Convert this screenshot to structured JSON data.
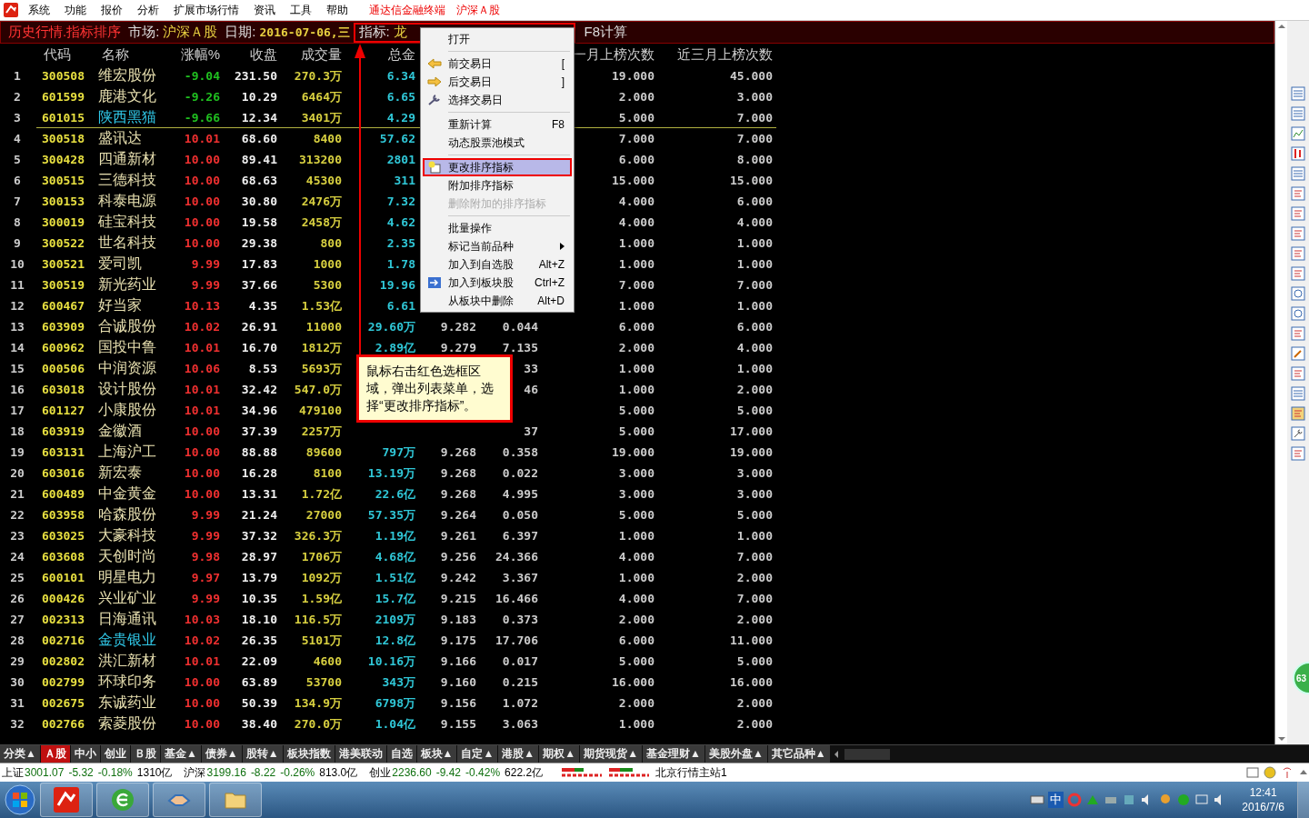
{
  "menubar": {
    "items": [
      "系统",
      "功能",
      "报价",
      "分析",
      "扩展市场行情",
      "资讯",
      "工具",
      "帮助"
    ],
    "brand": "通达信金融终端",
    "market": "沪深Ａ股"
  },
  "header": {
    "title": "历史行情.指标排序",
    "market_label": "市场:",
    "market": "沪深Ａ股",
    "date_label": "日期:",
    "date": "2016-07-06,三",
    "indicator_label": "指标:",
    "indicator": "龙",
    "recalc": "F8计算"
  },
  "table": {
    "columns": [
      "代码",
      "名称",
      "涨幅%",
      "收盘",
      "成交量",
      "总金",
      null,
      null,
      "一月上榜次数",
      "近三月上榜次数"
    ],
    "top_rows": [
      {
        "no": "1",
        "marked": false,
        "cells": [
          "300508",
          "维宏股份",
          "-9.04",
          "231.50",
          "270.3万",
          "6.34",
          null,
          null,
          "19.000",
          "45.000"
        ]
      },
      {
        "no": "2",
        "marked": false,
        "cells": [
          "601599",
          "鹿港文化",
          "-9.26",
          "10.29",
          "6464万",
          "6.65",
          null,
          null,
          "2.000",
          "3.000"
        ]
      },
      {
        "no": "3",
        "marked": true,
        "cells": [
          "601015",
          "陕西黑猫",
          "-9.66",
          "12.34",
          "3401万",
          "4.29",
          null,
          null,
          "5.000",
          "7.000"
        ]
      }
    ],
    "rows": [
      {
        "no": "4",
        "marked": false,
        "cells": [
          "300518",
          "盛讯达",
          "10.01",
          "68.60",
          "8400",
          "57.62",
          null,
          null,
          "7.000",
          "7.000"
        ]
      },
      {
        "no": "5",
        "marked": false,
        "cells": [
          "300428",
          "四通新材",
          "10.00",
          "89.41",
          "313200",
          "2801",
          null,
          null,
          "6.000",
          "8.000"
        ]
      },
      {
        "no": "6",
        "marked": false,
        "cells": [
          "300515",
          "三德科技",
          "10.00",
          "68.63",
          "45300",
          "311",
          null,
          null,
          "15.000",
          "15.000"
        ]
      },
      {
        "no": "7",
        "marked": false,
        "cells": [
          "300153",
          "科泰电源",
          "10.00",
          "30.80",
          "2476万",
          "7.32",
          null,
          null,
          "4.000",
          "6.000"
        ]
      },
      {
        "no": "8",
        "marked": false,
        "cells": [
          "300019",
          "硅宝科技",
          "10.00",
          "19.58",
          "2458万",
          "4.62",
          null,
          null,
          "4.000",
          "4.000"
        ]
      },
      {
        "no": "9",
        "marked": false,
        "cells": [
          "300522",
          "世名科技",
          "10.00",
          "29.38",
          "800",
          "2.35",
          null,
          null,
          "1.000",
          "1.000"
        ]
      },
      {
        "no": "10",
        "marked": false,
        "cells": [
          "300521",
          "爱司凯",
          "9.99",
          "17.83",
          "1000",
          "1.78",
          null,
          null,
          "1.000",
          "1.000"
        ]
      },
      {
        "no": "11",
        "marked": false,
        "cells": [
          "300519",
          "新光药业",
          "9.99",
          "37.66",
          "5300",
          "19.96",
          null,
          null,
          "7.000",
          "7.000"
        ]
      },
      {
        "no": "12",
        "marked": false,
        "cells": [
          "600467",
          "好当家",
          "10.13",
          "4.35",
          "1.53亿",
          "6.61",
          null,
          null,
          "1.000",
          "1.000"
        ]
      },
      {
        "no": "13",
        "marked": false,
        "cells": [
          "603909",
          "合诚股份",
          "10.02",
          "26.91",
          "11000",
          "29.60万",
          "9.282",
          "0.044",
          "6.000",
          "6.000"
        ]
      },
      {
        "no": "14",
        "marked": false,
        "cells": [
          "600962",
          "国投中鲁",
          "10.01",
          "16.70",
          "1812万",
          "2.89亿",
          "9.279",
          "7.135",
          "2.000",
          "4.000"
        ]
      },
      {
        "no": "15",
        "marked": false,
        "cells": [
          "000506",
          "中润资源",
          "10.06",
          "8.53",
          "5693万",
          null,
          null,
          "33",
          "1.000",
          "1.000"
        ]
      },
      {
        "no": "16",
        "marked": false,
        "cells": [
          "603018",
          "设计股份",
          "10.01",
          "32.42",
          "547.0万",
          null,
          null,
          "46",
          "1.000",
          "2.000"
        ]
      },
      {
        "no": "17",
        "marked": false,
        "cells": [
          "601127",
          "小康股份",
          "10.01",
          "34.96",
          "479100",
          null,
          null,
          null,
          "5.000",
          "5.000"
        ]
      },
      {
        "no": "18",
        "marked": false,
        "cells": [
          "603919",
          "金徽酒",
          "10.00",
          "37.39",
          "2257万",
          null,
          null,
          "37",
          "5.000",
          "17.000"
        ]
      },
      {
        "no": "19",
        "marked": false,
        "cells": [
          "603131",
          "上海沪工",
          "10.00",
          "88.88",
          "89600",
          "797万",
          "9.268",
          "0.358",
          "19.000",
          "19.000"
        ]
      },
      {
        "no": "20",
        "marked": false,
        "cells": [
          "603016",
          "新宏泰",
          "10.00",
          "16.28",
          "8100",
          "13.19万",
          "9.268",
          "0.022",
          "3.000",
          "3.000"
        ]
      },
      {
        "no": "21",
        "marked": false,
        "cells": [
          "600489",
          "中金黄金",
          "10.00",
          "13.31",
          "1.72亿",
          "22.6亿",
          "9.268",
          "4.995",
          "3.000",
          "3.000"
        ]
      },
      {
        "no": "22",
        "marked": false,
        "cells": [
          "603958",
          "哈森股份",
          "9.99",
          "21.24",
          "27000",
          "57.35万",
          "9.264",
          "0.050",
          "5.000",
          "5.000"
        ]
      },
      {
        "no": "23",
        "marked": false,
        "cells": [
          "603025",
          "大豪科技",
          "9.99",
          "37.32",
          "326.3万",
          "1.19亿",
          "9.261",
          "6.397",
          "1.000",
          "1.000"
        ]
      },
      {
        "no": "24",
        "marked": false,
        "cells": [
          "603608",
          "天创时尚",
          "9.98",
          "28.97",
          "1706万",
          "4.68亿",
          "9.256",
          "24.366",
          "4.000",
          "7.000"
        ]
      },
      {
        "no": "25",
        "marked": false,
        "cells": [
          "600101",
          "明星电力",
          "9.97",
          "13.79",
          "1092万",
          "1.51亿",
          "9.242",
          "3.367",
          "1.000",
          "2.000"
        ]
      },
      {
        "no": "26",
        "marked": false,
        "cells": [
          "000426",
          "兴业矿业",
          "9.99",
          "10.35",
          "1.59亿",
          "15.7亿",
          "9.215",
          "16.466",
          "4.000",
          "7.000"
        ]
      },
      {
        "no": "27",
        "marked": false,
        "cells": [
          "002313",
          "日海通讯",
          "10.03",
          "18.10",
          "116.5万",
          "2109万",
          "9.183",
          "0.373",
          "2.000",
          "2.000"
        ]
      },
      {
        "no": "28",
        "marked": true,
        "cells": [
          "002716",
          "金贵银业",
          "10.02",
          "26.35",
          "5101万",
          "12.8亿",
          "9.175",
          "17.706",
          "6.000",
          "11.000"
        ]
      },
      {
        "no": "29",
        "marked": false,
        "cells": [
          "002802",
          "洪汇新材",
          "10.01",
          "22.09",
          "4600",
          "10.16万",
          "9.166",
          "0.017",
          "5.000",
          "5.000"
        ]
      },
      {
        "no": "30",
        "marked": false,
        "cells": [
          "002799",
          "环球印务",
          "10.00",
          "63.89",
          "53700",
          "343万",
          "9.160",
          "0.215",
          "16.000",
          "16.000"
        ]
      },
      {
        "no": "31",
        "marked": false,
        "cells": [
          "002675",
          "东诚药业",
          "10.00",
          "50.39",
          "134.9万",
          "6798万",
          "9.156",
          "1.072",
          "2.000",
          "2.000"
        ]
      },
      {
        "no": "32",
        "marked": false,
        "cells": [
          "002766",
          "索菱股份",
          "10.00",
          "38.40",
          "270.0万",
          "1.04亿",
          "9.155",
          "3.063",
          "1.000",
          "2.000"
        ]
      }
    ]
  },
  "context_menu": {
    "groups": [
      [
        {
          "label": "打开",
          "selected": false,
          "disabled": false,
          "submenu": false
        }
      ],
      [
        {
          "label": "前交易日",
          "shortcut": "[",
          "selected": false,
          "disabled": false,
          "submenu": false
        },
        {
          "label": "后交易日",
          "shortcut": "]",
          "selected": false,
          "disabled": false,
          "submenu": false
        },
        {
          "label": "选择交易日",
          "selected": false,
          "disabled": false,
          "submenu": false
        }
      ],
      [
        {
          "label": "重新计算",
          "shortcut": "F8",
          "selected": false,
          "disabled": false,
          "submenu": false
        },
        {
          "label": "动态股票池模式",
          "selected": false,
          "disabled": false,
          "submenu": false
        }
      ],
      [
        {
          "label": "更改排序指标",
          "selected": true,
          "disabled": false,
          "submenu": false
        },
        {
          "label": "附加排序指标",
          "selected": false,
          "disabled": false,
          "submenu": false
        },
        {
          "label": "删除附加的排序指标",
          "selected": false,
          "disabled": true,
          "submenu": false
        }
      ],
      [
        {
          "label": "批量操作",
          "selected": false,
          "disabled": false,
          "submenu": false
        },
        {
          "label": "标记当前品种",
          "selected": false,
          "disabled": false,
          "submenu": true
        },
        {
          "label": "加入到自选股",
          "shortcut": "Alt+Z",
          "selected": false,
          "disabled": false,
          "submenu": false
        },
        {
          "label": "加入到板块股",
          "shortcut": "Ctrl+Z",
          "selected": false,
          "disabled": false,
          "submenu": false
        },
        {
          "label": "从板块中删除",
          "shortcut": "Alt+D",
          "selected": false,
          "disabled": false,
          "submenu": false
        }
      ]
    ]
  },
  "callout": {
    "text": "鼠标右击红色选框区域，弹出列表菜单，选择“更改排序指标”。"
  },
  "edge_badge": "63",
  "bottom_tabs": [
    {
      "label": "分类▲",
      "selected": false
    },
    {
      "label": "Ａ股",
      "selected": true
    },
    {
      "label": "中小",
      "selected": false
    },
    {
      "label": "创业",
      "selected": false
    },
    {
      "label": "Ｂ股",
      "selected": false
    },
    {
      "label": "基金▲",
      "selected": false
    },
    {
      "label": "债券▲",
      "selected": false
    },
    {
      "label": "股转▲",
      "selected": false
    },
    {
      "label": "板块指数",
      "selected": false
    },
    {
      "label": "港美联动",
      "selected": false
    },
    {
      "label": "自选",
      "selected": false
    },
    {
      "label": "板块▲",
      "selected": false
    },
    {
      "label": "自定▲",
      "selected": false
    },
    {
      "label": "港股▲",
      "selected": false
    },
    {
      "label": "期权▲",
      "selected": false
    },
    {
      "label": "期货现货▲",
      "selected": false
    },
    {
      "label": "基金理财▲",
      "selected": false
    },
    {
      "label": "美股外盘▲",
      "selected": false
    },
    {
      "label": "其它品种▲",
      "selected": false
    }
  ],
  "status_bar": {
    "indices": [
      {
        "name": "上证",
        "value": "3001.07",
        "change": "-5.32",
        "pct": "-0.18%",
        "amount": "1310亿"
      },
      {
        "name": "沪深",
        "value": "3199.16",
        "change": "-8.22",
        "pct": "-0.26%",
        "amount": "813.0亿"
      },
      {
        "name": "创业",
        "value": "2236.60",
        "change": "-9.42",
        "pct": "-0.42%",
        "amount": "622.2亿"
      }
    ],
    "server": "北京行情主站1"
  },
  "taskbar": {
    "ime": "中",
    "time": "12:41",
    "date": "2016/7/6"
  }
}
